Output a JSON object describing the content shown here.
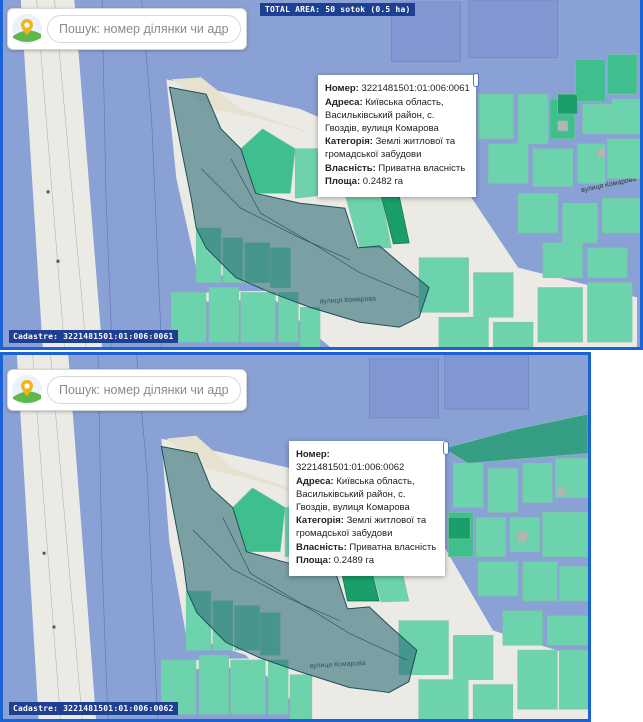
{
  "colors": {
    "map_base": "#8aa1d6",
    "road": "#eceae4",
    "parcel_light": "#6dd3ad",
    "parcel_medium": "#3fbf8d",
    "parcel_dark": "#1a9e6a",
    "selection": "#2e6e7a",
    "label_bg": "#1e3f92",
    "frame": "#1a63d6"
  },
  "search": {
    "placeholder": "Пошук: номер ділянки чи адреса",
    "logo_icon": "pin-landscape-icon"
  },
  "total_area": {
    "text": "TOTAL AREA: 50 sotok (0.5 ha)"
  },
  "street_names": {
    "komarova": "вулиця Комарова"
  },
  "panels": [
    {
      "cadastre_text": "Cadastre: 3221481501:01:006:0061",
      "popup": {
        "number_label": "Номер:",
        "number_value": "3221481501:01:006:0061",
        "address_label": "Адреса:",
        "address_value": "Київська область, Васильківський район, с. Гвоздів, вулиця Комарова",
        "category_label": "Категорія:",
        "category_value": "Землі житлової та громадської забудови",
        "ownership_label": "Власність:",
        "ownership_value": "Приватна власність",
        "area_label": "Площа:",
        "area_value": "0.2482 га"
      }
    },
    {
      "cadastre_text": "Cadastre: 3221481501:01:006:0062",
      "popup": {
        "number_label": "Номер:",
        "number_value": "3221481501:01:006:0062",
        "address_label": "Адреса:",
        "address_value": "Київська область, Васильківський район, с. Гвоздів, вулиця Комарова",
        "category_label": "Категорія:",
        "category_value": "Землі житлової та громадської забудови",
        "ownership_label": "Власність:",
        "ownership_value": "Приватна власність",
        "area_label": "Площа:",
        "area_value": "0.2489 га"
      }
    }
  ]
}
